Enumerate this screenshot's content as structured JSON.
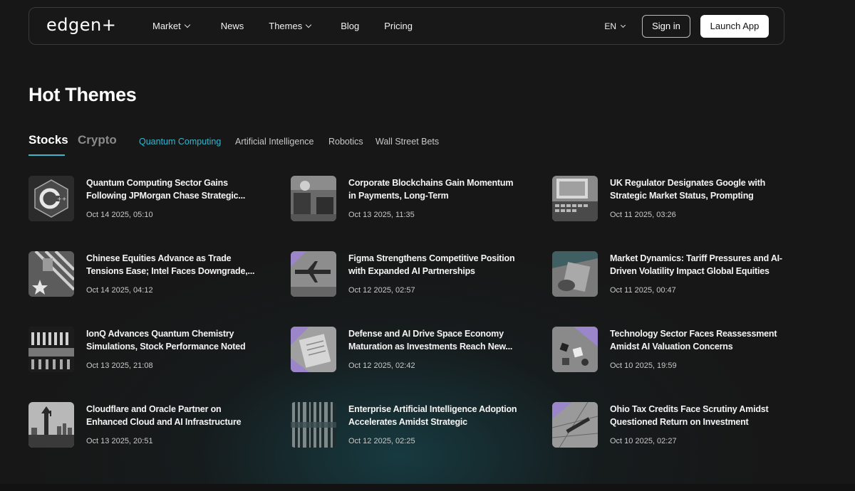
{
  "nav": {
    "logo": "edgen+",
    "links": [
      {
        "label": "Market",
        "dropdown": true
      },
      {
        "label": "News",
        "dropdown": false
      },
      {
        "label": "Themes",
        "dropdown": true
      },
      {
        "label": "Blog",
        "dropdown": false
      },
      {
        "label": "Pricing",
        "dropdown": false
      }
    ],
    "language": "EN",
    "sign_in": "Sign in",
    "launch_app": "Launch App"
  },
  "page": {
    "title": "Hot Themes"
  },
  "tabs": {
    "main": [
      "Stocks",
      "Crypto"
    ],
    "main_active": "Stocks",
    "sub": [
      "Quantum Computing",
      "Artificial Intelligence",
      "Robotics",
      "Wall Street Bets"
    ],
    "sub_active": "Quantum Computing"
  },
  "colors": {
    "background": "#171717",
    "accent": "#3ab4cc",
    "thumb_purple": "#9b86c9"
  },
  "articles": [
    {
      "title": "Quantum Computing Sector Gains Following JPMorgan Chase Strategic...",
      "date": "Oct 14 2025, 05:10",
      "thumb": "cpp-logo"
    },
    {
      "title": "Corporate Blockchains Gain Momentum in Payments, Long-Term Decentralization...",
      "date": "Oct 13 2025, 11:35",
      "thumb": "office-desk"
    },
    {
      "title": "UK Regulator Designates Google with Strategic Market Status, Prompting Marke...",
      "date": "Oct 11 2025, 03:26",
      "thumb": "laptop-keyboard"
    },
    {
      "title": "Chinese Equities Advance as Trade Tensions Ease; Intel Faces Downgrade,...",
      "date": "Oct 14 2025, 04:12",
      "thumb": "flags"
    },
    {
      "title": "Figma Strengthens Competitive Position with Expanded AI Partnerships",
      "date": "Oct 12 2025, 02:57",
      "thumb": "airplane"
    },
    {
      "title": "Market Dynamics: Tariff Pressures and AI-Driven Volatility Impact Global Equities",
      "date": "Oct 11 2025, 00:47",
      "thumb": "hand-paper"
    },
    {
      "title": "IonQ Advances Quantum Chemistry Simulations, Stock Performance Noted",
      "date": "Oct 13 2025, 21:08",
      "thumb": "chip-pins"
    },
    {
      "title": "Defense and AI Drive Space Economy Maturation as Investments Reach New...",
      "date": "Oct 12 2025, 02:42",
      "thumb": "papers"
    },
    {
      "title": "Technology Sector Faces Reassessment Amidst AI Valuation Concerns",
      "date": "Oct 10 2025, 19:59",
      "thumb": "game-pieces"
    },
    {
      "title": "Cloudflare and Oracle Partner on Enhanced Cloud and AI Infrastructure",
      "date": "Oct 13 2025, 20:51",
      "thumb": "statue-city"
    },
    {
      "title": "Enterprise Artificial Intelligence Adoption Accelerates Amidst Strategic Partnerships...",
      "date": "Oct 12 2025, 02:25",
      "thumb": "server-room"
    },
    {
      "title": "Ohio Tax Credits Face Scrutiny Amidst Questioned Return on Investment",
      "date": "Oct 10 2025, 02:27",
      "thumb": "map-pen"
    }
  ]
}
